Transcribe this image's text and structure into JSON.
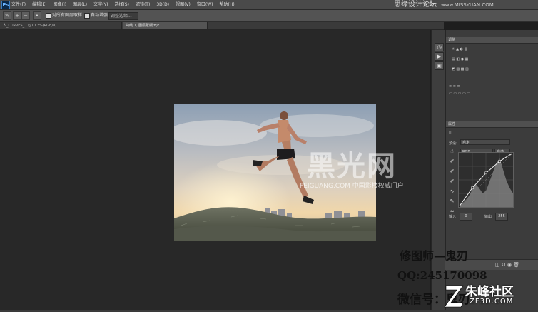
{
  "menubar": {
    "app_logo": "Ps",
    "items": [
      "文件(F)",
      "编辑(E)",
      "图像(I)",
      "图层(L)",
      "文字(Y)",
      "选择(S)",
      "滤镜(T)",
      "3D(D)",
      "视图(V)",
      "窗口(W)",
      "帮助(H)"
    ]
  },
  "top_watermark": {
    "text": "思缘设计论坛",
    "url": "www.MISSYUAN.COM"
  },
  "options_bar": {
    "label_sample_all": "对所有图层取样",
    "label_auto_enhance": "自动增强",
    "refine_edge": "调整边缘..."
  },
  "doc_tabs": [
    {
      "label": "人_CURVES_...@10.3%(RGB/8)",
      "active": false
    },
    {
      "label": "曲线 1, 图层蒙版/8)*",
      "active": true
    }
  ],
  "panels": {
    "adjust_header": "调整",
    "properties_header": "属性",
    "preset_label": "预设:",
    "preset_value": "自定",
    "channel_value": "RGB",
    "auto_button": "自动",
    "curve_input_labels": [
      "输入",
      "输出"
    ],
    "curve_input_values": [
      "0",
      "255"
    ]
  },
  "photo": {
    "brand_logo_text": "黑光网",
    "brand_sub_text": "FEIGUANG.COM 中国影楼权威门户"
  },
  "credit_overlay": {
    "line1": "修图师—鬼刃",
    "line2": "QQ:245170098",
    "line3": "微信号：鬼刃"
  },
  "corner_watermark": {
    "name": "朱峰社区",
    "url": "ZF3D.COM"
  },
  "chart_data": {
    "type": "area",
    "title": "",
    "xlabel": "",
    "ylabel": "",
    "x": [
      0,
      16,
      32,
      48,
      64,
      80,
      96,
      112,
      128,
      144,
      160,
      176,
      192,
      208,
      224,
      240,
      255
    ],
    "values": [
      2,
      5,
      10,
      18,
      28,
      36,
      30,
      22,
      26,
      40,
      55,
      70,
      78,
      60,
      42,
      30,
      22
    ],
    "curve_points": [
      [
        0,
        0
      ],
      [
        64,
        90
      ],
      [
        128,
        160
      ],
      [
        192,
        215
      ],
      [
        255,
        255
      ]
    ],
    "xlim": [
      0,
      255
    ],
    "ylim": [
      0,
      255
    ],
    "grid": true
  },
  "colors": {
    "accent": "#3d7fc1",
    "panel": "#3c3c3c",
    "canvas": "#282828"
  }
}
